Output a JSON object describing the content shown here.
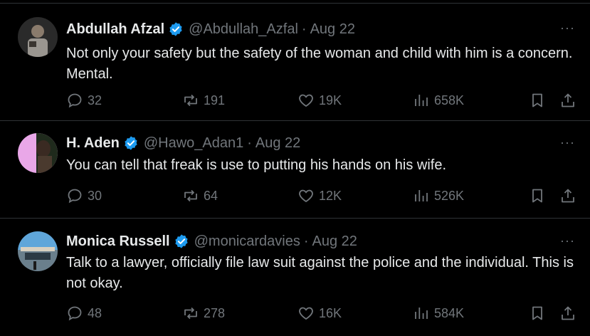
{
  "tweets": [
    {
      "name": "Abdullah Afzal",
      "handle": "@Abdullah_Azfal",
      "separator": "·",
      "time": "Aug 22",
      "more": "···",
      "text": "Not only your safety but the safety of the woman and child with him is a concern. Mental.",
      "replies": "32",
      "reposts": "191",
      "likes": "19K",
      "views": "658K"
    },
    {
      "name": "H. Aden",
      "handle": "@Hawo_Adan1",
      "separator": "·",
      "time": "Aug 22",
      "more": "···",
      "text": "You can tell that freak is use to putting his hands on his wife.",
      "replies": "30",
      "reposts": "64",
      "likes": "12K",
      "views": "526K"
    },
    {
      "name": "Monica Russell",
      "handle": "@monicardavies",
      "separator": "·",
      "time": "Aug 22",
      "more": "···",
      "text": "Talk to a lawyer, officially file law suit against the police and the individual. This is not okay.",
      "replies": "48",
      "reposts": "278",
      "likes": "16K",
      "views": "584K"
    }
  ],
  "icons": {
    "verified": "verified-badge-icon",
    "reply": "reply-icon",
    "repost": "repost-icon",
    "like": "heart-icon",
    "views": "views-icon",
    "bookmark": "bookmark-icon",
    "share": "share-icon"
  },
  "colors": {
    "background": "#000000",
    "text": "#e7e9ea",
    "muted": "#71767b",
    "verified": "#1d9bf0",
    "divider": "#2f3336"
  }
}
